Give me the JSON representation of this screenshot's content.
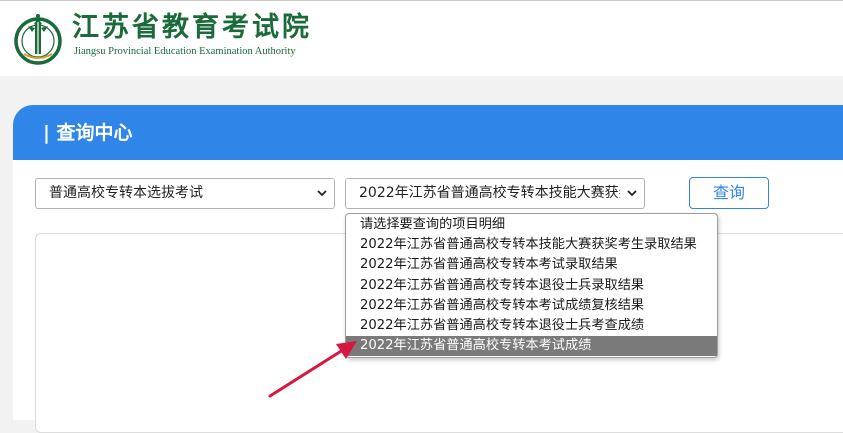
{
  "header": {
    "logo_title": "江苏省教育考试院",
    "logo_subtitle": "Jiangsu Provincial Education Examination Authority",
    "logo_icon": "provincial-emblem"
  },
  "panel": {
    "title": "| 查询中心"
  },
  "filters": {
    "exam_type": {
      "selected": "普通高校专转本选拔考试"
    },
    "query_item": {
      "selected": "2022年江苏省普通高校专转本技能大赛获奖考生录取结果"
    },
    "query_button_label": "查询"
  },
  "dropdown": {
    "options": [
      {
        "label": "请选择要查询的项目明细",
        "highlighted": false
      },
      {
        "label": "2022年江苏省普通高校专转本技能大赛获奖考生录取结果",
        "highlighted": false
      },
      {
        "label": "2022年江苏省普通高校专转本考试录取结果",
        "highlighted": false
      },
      {
        "label": "2022年江苏省普通高校专转本退役士兵录取结果",
        "highlighted": false
      },
      {
        "label": "2022年江苏省普通高校专转本考试成绩复核结果",
        "highlighted": false
      },
      {
        "label": "2022年江苏省普通高校专转本退役士兵考查成绩",
        "highlighted": false
      },
      {
        "label": "2022年江苏省普通高校专转本考试成绩",
        "highlighted": true
      }
    ]
  },
  "colors": {
    "brand_green": "#1b6a3a",
    "panel_blue": "#2f86e8",
    "highlight_gray": "#7a7a7a",
    "annotation_red": "#d6183f"
  }
}
